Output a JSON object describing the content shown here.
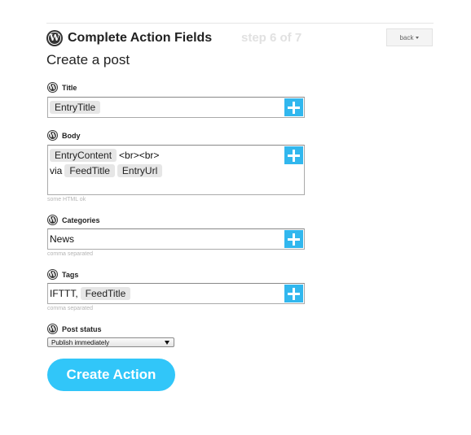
{
  "header": {
    "title": "Complete Action Fields",
    "step": "step 6 of 7",
    "back_label": "back",
    "subtitle": "Create a post",
    "logo_letter": "W"
  },
  "fields": {
    "title": {
      "label": "Title",
      "tokens": [
        "EntryTitle"
      ]
    },
    "body": {
      "label": "Body",
      "line1": {
        "token1": "EntryContent",
        "text": "<br><br>"
      },
      "line2": {
        "text": "via",
        "token1": "FeedTitle",
        "token2": "EntryUrl"
      },
      "hint": "some HTML ok"
    },
    "categories": {
      "label": "Categories",
      "value": "News",
      "hint": "comma separated"
    },
    "tags": {
      "label": "Tags",
      "text": "IFTTT,",
      "token1": "FeedTitle",
      "hint": "comma separated"
    },
    "post_status": {
      "label": "Post status",
      "selected": "Publish immediately"
    }
  },
  "actions": {
    "create_label": "Create Action"
  },
  "colors": {
    "accent_button": "#31c6f9",
    "plus_button": "#31b7ee",
    "step_text": "#e1e1e1"
  },
  "icons": {
    "logo": "wordpress-icon",
    "add": "plus-icon",
    "dropdown": "triangle-down-icon"
  }
}
